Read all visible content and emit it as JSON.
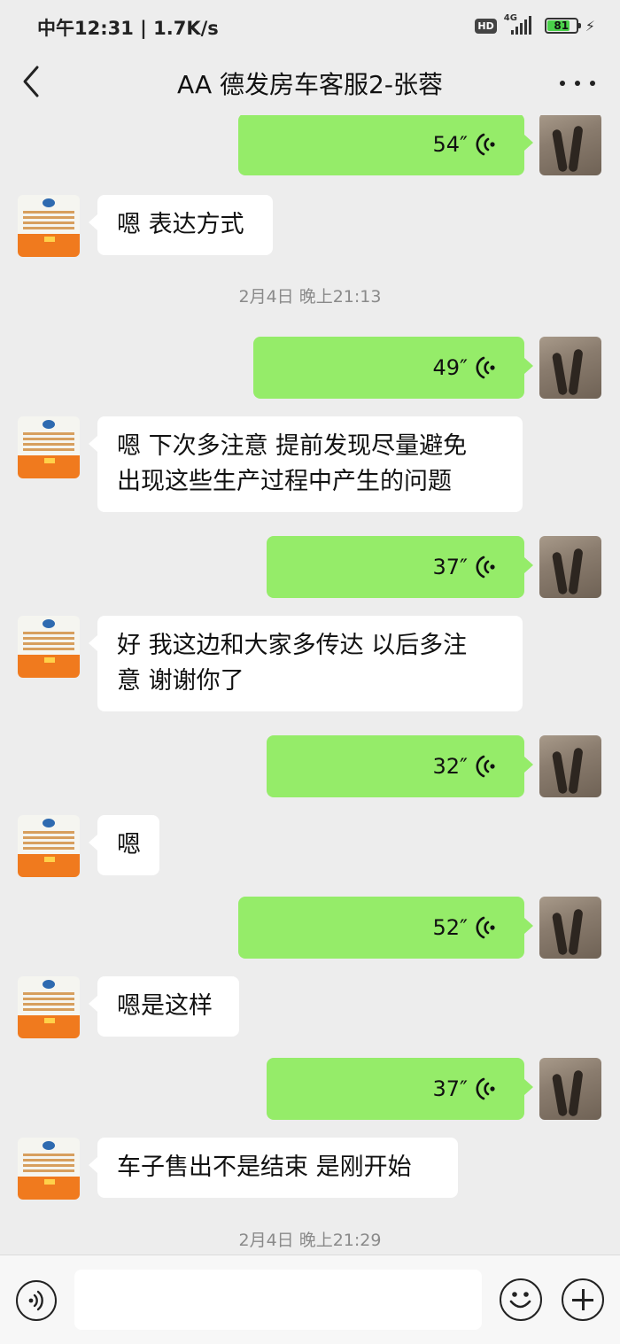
{
  "status_bar": {
    "time": "中午12:31 | 1.7K/s",
    "hd": "HD",
    "network": "4G",
    "battery": 81,
    "battery_label": "81",
    "battery_color": "#4ad14a"
  },
  "header": {
    "title": "AA 德发房车客服2-张蓉",
    "back_icon": "chevron-left-icon",
    "more_icon": "more-dots-icon"
  },
  "colors": {
    "self_bubble": "#95ec69",
    "other_bubble": "#ffffff",
    "background": "#ededed"
  },
  "messages": [
    {
      "side": "right",
      "type": "voice",
      "duration": "54″"
    },
    {
      "side": "left",
      "type": "text",
      "text": "嗯 表达方式"
    },
    {
      "type": "time",
      "text": "2月4日 晚上21:13"
    },
    {
      "side": "right",
      "type": "voice",
      "duration": "49″"
    },
    {
      "side": "left",
      "type": "text",
      "lines": [
        "嗯 下次多注意 提前发现尽量避免",
        "出现这些生产过程中产生的问题"
      ]
    },
    {
      "side": "right",
      "type": "voice",
      "duration": "37″"
    },
    {
      "side": "left",
      "type": "text",
      "lines": [
        "好 我这边和大家多传达 以后多注",
        "意 谢谢你了"
      ]
    },
    {
      "side": "right",
      "type": "voice",
      "duration": "32″"
    },
    {
      "side": "left",
      "type": "text",
      "text": "嗯"
    },
    {
      "side": "right",
      "type": "voice",
      "duration": "52″"
    },
    {
      "side": "left",
      "type": "text",
      "text": "嗯是这样"
    },
    {
      "side": "right",
      "type": "voice",
      "duration": "37″"
    },
    {
      "side": "left",
      "type": "text",
      "text": "车子售出不是结束 是刚开始"
    },
    {
      "type": "time",
      "text": "2月4日 晚上21:29"
    }
  ],
  "input_bar": {
    "voice_icon": "voice-input-icon",
    "emoji_icon": "emoji-icon",
    "plus_icon": "plus-icon",
    "input_value": "",
    "input_placeholder": ""
  }
}
